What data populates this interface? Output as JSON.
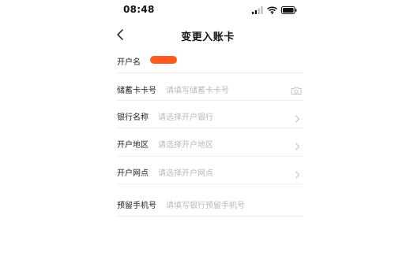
{
  "status_bar": {
    "time": "08:48"
  },
  "nav": {
    "title": "变更入账卡",
    "back_icon": "chevron-left-icon"
  },
  "form": {
    "account_name": {
      "label": "开户名",
      "value_redacted": true
    },
    "card_number": {
      "label": "储蓄卡卡号",
      "placeholder": "请填写储蓄卡卡号",
      "icon": "camera-icon"
    },
    "bank_name": {
      "label": "银行名称",
      "placeholder": "请选择开户银行",
      "icon": "chevron-right-icon"
    },
    "bank_region": {
      "label": "开户地区",
      "placeholder": "请选择开户地区",
      "icon": "chevron-right-icon"
    },
    "bank_branch": {
      "label": "开户网点",
      "placeholder": "请选择开户网点",
      "icon": "chevron-right-icon"
    },
    "phone": {
      "label": "预留手机号",
      "placeholder": "请填写银行预留手机号"
    }
  },
  "colors": {
    "redaction": "#ff5a1f",
    "placeholder": "#b8b8b8",
    "divider": "#eeeeee",
    "text": "#222222"
  }
}
